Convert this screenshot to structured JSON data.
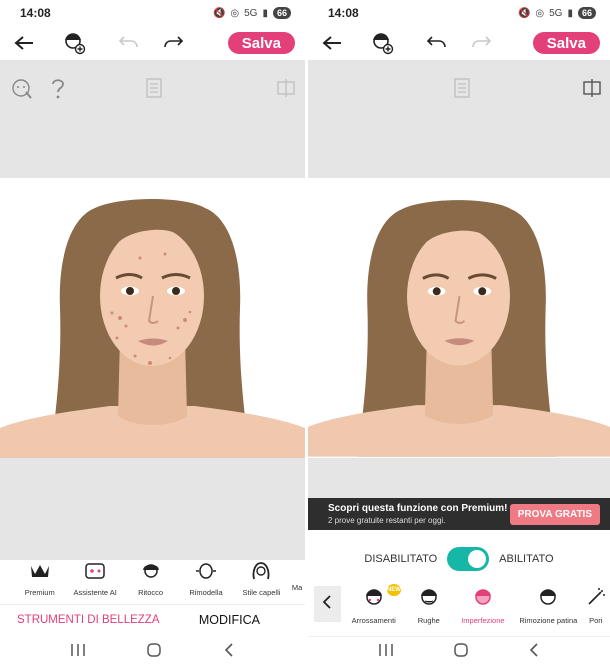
{
  "status_bar": {
    "time": "14:08",
    "network": "5G",
    "battery": "66"
  },
  "toolbar": {
    "save_label": "Salva"
  },
  "left": {
    "tools": [
      {
        "label": "Premium",
        "icon": "crown-icon"
      },
      {
        "label": "Assistente AI",
        "icon": "ai-assistant-icon"
      },
      {
        "label": "Ritocco",
        "icon": "retouch-icon"
      },
      {
        "label": "Rimodella",
        "icon": "reshape-icon"
      },
      {
        "label": "Stile capelli",
        "icon": "hair-style-icon"
      },
      {
        "label": "Ma",
        "icon": "makeup-icon"
      }
    ],
    "tabs": {
      "beauty": "STRUMENTI DI BELLEZZA",
      "modifica": "MODIFICA"
    }
  },
  "right": {
    "premium": {
      "title": "Scopri questa funzione con Premium!",
      "subtitle": "2 prove gratuite restanti per oggi.",
      "button": "PROVA GRATIS"
    },
    "toggle": {
      "off_label": "DISABILITATO",
      "on_label": "ABILITATO",
      "enabled": true
    },
    "tools": [
      {
        "label": "Arrossamenti",
        "icon": "redness-icon",
        "badge": "NEW"
      },
      {
        "label": "Rughe",
        "icon": "wrinkles-icon"
      },
      {
        "label": "Imperfezione",
        "icon": "blemish-icon",
        "active": true
      },
      {
        "label": "Rimozione patina",
        "icon": "shine-removal-icon"
      },
      {
        "label": "Pori",
        "icon": "pores-icon"
      }
    ]
  },
  "colors": {
    "accent": "#e3407a",
    "toggle": "#17b7a8",
    "canvas": "#e5e5e5",
    "premium_bg": "#2e2e2e"
  }
}
